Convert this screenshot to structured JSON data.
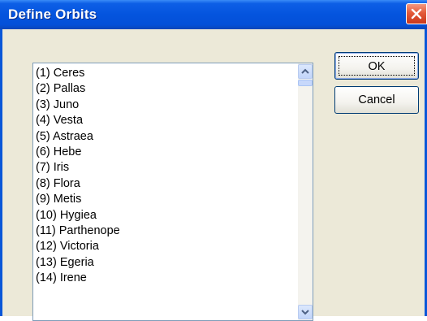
{
  "window": {
    "title": "Define Orbits"
  },
  "list": {
    "items": [
      "(1) Ceres",
      "(2) Pallas",
      "(3) Juno",
      "(4) Vesta",
      "(5) Astraea",
      "(6) Hebe",
      "(7) Iris",
      "(8) Flora",
      "(9) Metis",
      "(10) Hygiea",
      "(11) Parthenope",
      "(12) Victoria",
      "(13) Egeria",
      "(14) Irene"
    ]
  },
  "buttons": {
    "ok_label": "OK",
    "cancel_label": "Cancel"
  },
  "icons": {
    "close": "close-icon",
    "scroll_up": "arrow-up-icon",
    "scroll_down": "arrow-down-icon"
  },
  "colors": {
    "titlebar": "#0454de",
    "client_bg": "#ece9d8",
    "close_button": "#e45a3a"
  }
}
